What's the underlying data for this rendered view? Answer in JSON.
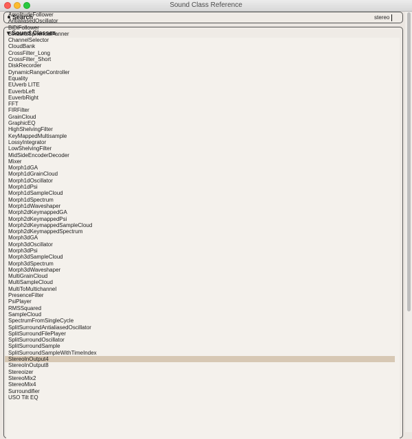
{
  "window": {
    "title": "Sound Class Reference"
  },
  "search": {
    "label": "Search",
    "value": "stereo"
  },
  "panel": {
    "header": "▾ Sound Classes"
  },
  "list": {
    "selected_index": 54,
    "items": [
      "AmplitudeFollower",
      "AntialiasedOscillator",
      "BiDiFollower",
      "BinauralSphericalPanner",
      "ChannelSelector",
      "CloudBank",
      "CrossFilter_Long",
      "CrossFilter_Short",
      "DiskRecorder",
      "DynamicRangeController",
      "Equality",
      "EUverb LITE",
      "EuverbLeft",
      "EuverbRight",
      "FFT",
      "FIRFilter",
      "GrainCloud",
      "GraphicEQ",
      "HighShelvingFilter",
      "KeyMappedMultisample",
      "LossyIntegrator",
      "LowShelvingFilter",
      "MidSideEncoderDecoder",
      "Mixer",
      "Morph1dGA",
      "Morph1dGrainCloud",
      "Morph1dOscillator",
      "Morph1dPsi",
      "Morph1dSampleCloud",
      "Morph1dSpectrum",
      "Morph1dWaveshaper",
      "Morph2dKeymappedGA",
      "Morph2dKeymappedPsi",
      "Morph2dKeymappedSampleCloud",
      "Morph2dKeymappedSpectrum",
      "Morph3dGA",
      "Morph3dOscillator",
      "Morph3dPsi",
      "Morph3dSampleCloud",
      "Morph3dSpectrum",
      "Morph3dWaveshaper",
      "MultiGrainCloud",
      "MultiSampleCloud",
      "MultiToMultichannel",
      "PresenceFilter",
      "PsiPlayer",
      "RMSSquared",
      "SampleCloud",
      "SpectrumFromSingleCycle",
      "SplitSurroundAntialiasedOscillator",
      "SplitSurroundFilePlayer",
      "SplitSurroundOscillator",
      "SplitSurroundSample",
      "SplitSurroundSampleWithTimeIndex",
      "StereoInOutput4",
      "StereoInOutput8",
      "Stereoizer",
      "StereoMix2",
      "StereoMix4",
      "Surroundifier",
      "USO Tilt EQ"
    ]
  },
  "icons": {
    "close": "close-icon",
    "minimize": "minimize-icon",
    "zoom": "zoom-icon"
  },
  "colors": {
    "close": "#fc5f57",
    "minimize": "#fdbc2e",
    "zoom": "#28c840",
    "background": "#ebe6e1",
    "selection": "#d7c8b4"
  }
}
